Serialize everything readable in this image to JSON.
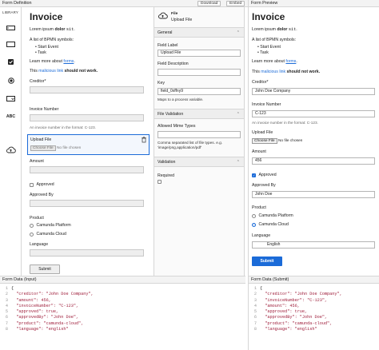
{
  "definition": {
    "header_title": "Form Definition",
    "download_label": "Download",
    "embed_label": "Embed"
  },
  "library": {
    "title": "LIBRARY",
    "items": [
      {
        "icon": "textfield-icon"
      },
      {
        "icon": "textarea-icon"
      },
      {
        "icon": "checkbox-icon"
      },
      {
        "icon": "radio-icon"
      },
      {
        "icon": "select-icon"
      },
      {
        "icon": "text-icon",
        "text": "ABC"
      },
      {
        "icon": "upload-cloud-icon"
      }
    ]
  },
  "form": {
    "title": "Invoice",
    "lorem_prefix": "Lorem ipsum ",
    "lorem_bold": "dolor",
    "lorem_code": "sit",
    "lorem_suffix": ".",
    "list_intro": "A list of BPMN symbols:",
    "list_items": [
      "Start Event",
      "Task"
    ],
    "learn_prefix": "Learn more about ",
    "learn_link": "forms",
    "learn_suffix": ".",
    "malicious_prefix": "This ",
    "malicious_link": "malicious link",
    "malicious_suffix": " should not work.",
    "creditor_label": "Creditor*",
    "invoice_label": "Invoice Number",
    "invoice_desc": "An invoice number in the format: C-123.",
    "upload_label": "Upload File",
    "choose_file": "Choose File",
    "no_file": "No file chosen",
    "amount_label": "Amount",
    "approved_label": "Approved",
    "approved_by_label": "Approved By",
    "product_label": "Product",
    "product_options": [
      "Camunda Platform",
      "Camunda Cloud"
    ],
    "language_label": "Language",
    "submit_label": "Submit"
  },
  "properties": {
    "type_label": "File",
    "name": "Upload File",
    "general": "General",
    "field_label_title": "Field Label",
    "field_label_value": "Upload File",
    "field_desc_title": "Field Description",
    "key_title": "Key",
    "key_value": "field_0xffny9",
    "key_desc": "Maps to a process variable.",
    "file_validation": "File Validation",
    "mime_title": "Allowed Mime Types",
    "mime_desc": "Comma separated list of file types. e.g. 'image/png,application/pdf'",
    "validation": "Validation",
    "required_title": "Required"
  },
  "preview": {
    "header_title": "Form Preview",
    "creditor_value": "John Doe Company",
    "invoice_value": "C-123",
    "amount_value": "456",
    "approved_by_value": "John Doe",
    "language_value": "English",
    "approved_checked": true,
    "product_selected": "Camunda Cloud"
  },
  "data_input": {
    "header_title": "Form Data (Input)",
    "lines": [
      "{",
      "  \"creditor\": \"John Doe Company\",",
      "  \"amount\": 456,",
      "  \"invoiceNumber\": \"C-123\",",
      "  \"approved\": true,",
      "  \"approvedBy\": \"John Doe\",",
      "  \"product\": \"camunda-cloud\",",
      "  \"language\": \"english\""
    ]
  },
  "data_submit": {
    "header_title": "Form Data (Submit)",
    "lines": [
      "{",
      "  \"creditor\": \"John Doe Company\",",
      "  \"invoiceNumber\": \"C-123\",",
      "  \"amount\": 456,",
      "  \"approved\": true,",
      "  \"approvedBy\": \"John Doe\",",
      "  \"product\": \"camunda-cloud\",",
      "  \"language\": \"english\""
    ]
  },
  "colors": {
    "accent": "#1b6bd8",
    "panel_header": "#f3f3f3",
    "selection": "#1b6bd8"
  }
}
